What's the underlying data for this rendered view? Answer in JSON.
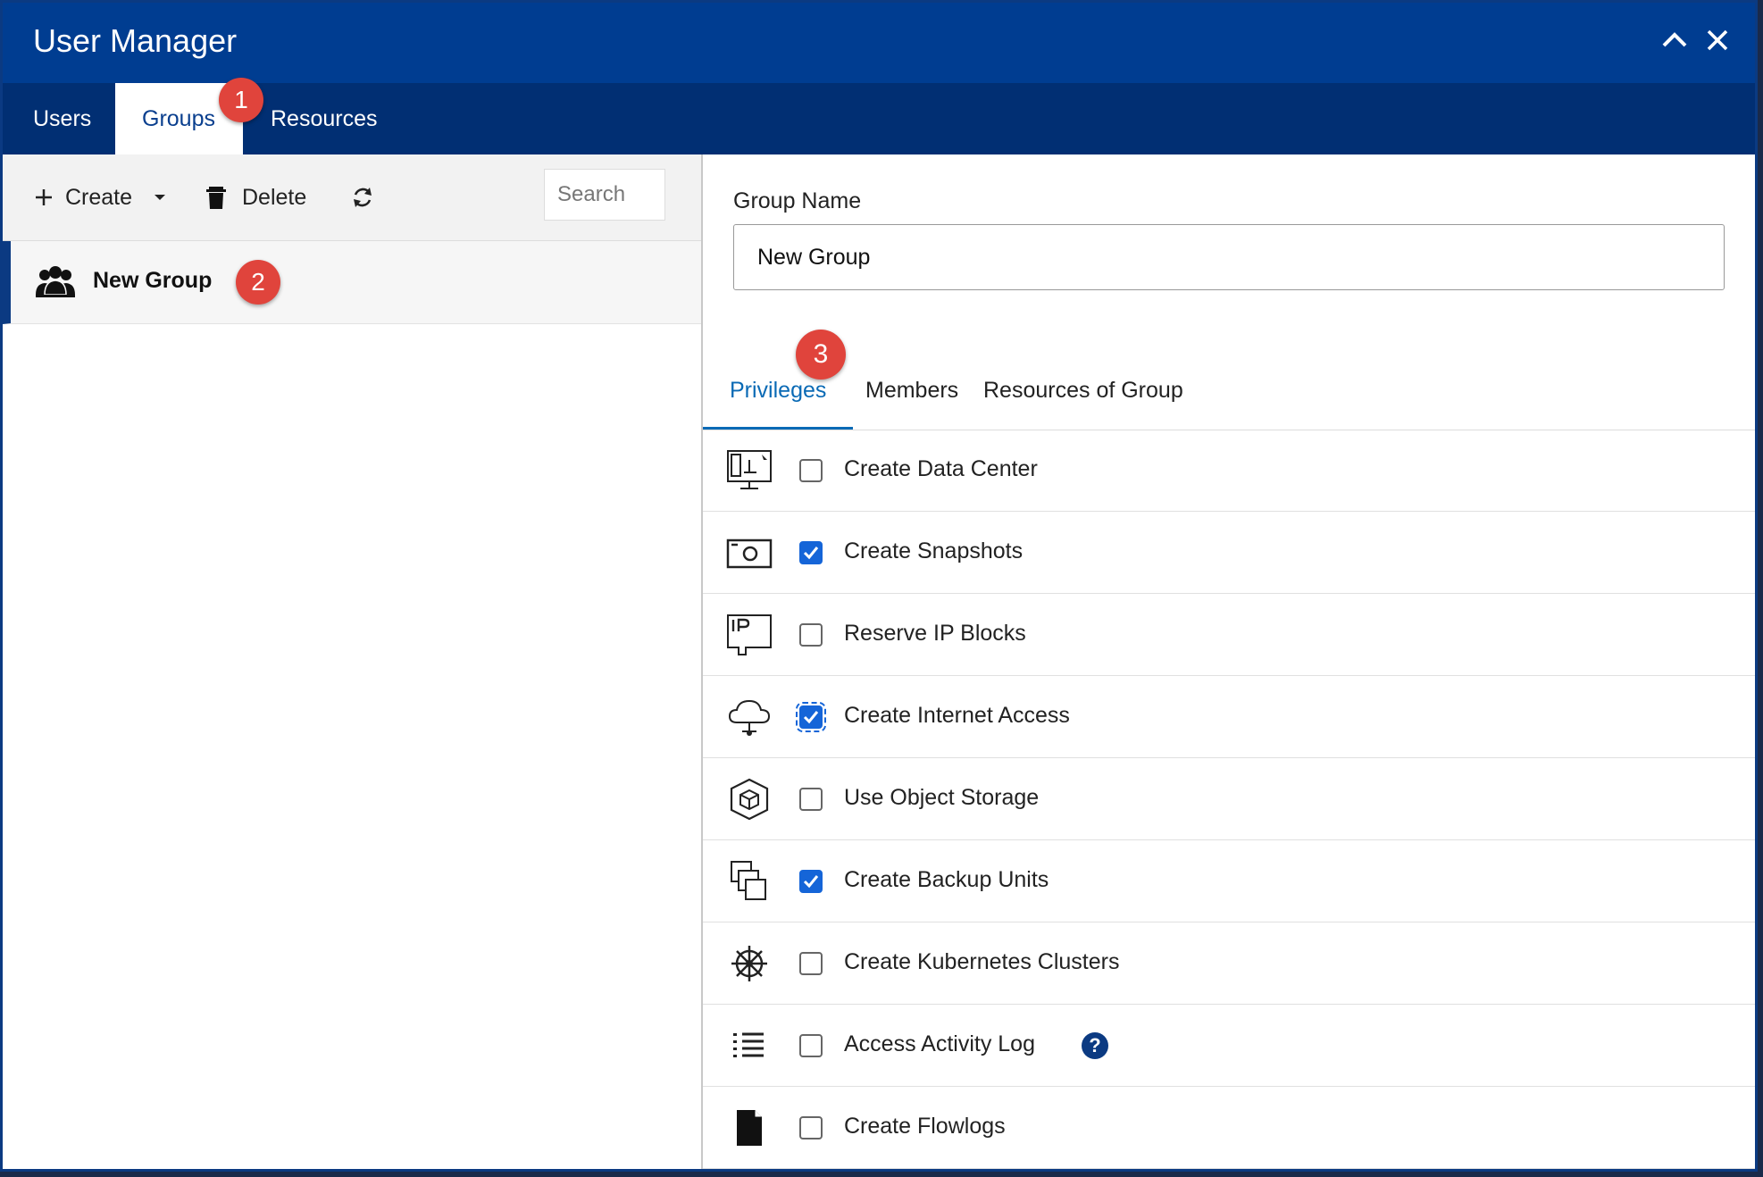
{
  "window": {
    "title": "User Manager"
  },
  "tabs": [
    {
      "label": "Users"
    },
    {
      "label": "Groups"
    },
    {
      "label": "Resources"
    }
  ],
  "toolbar": {
    "create_label": "Create",
    "delete_label": "Delete",
    "search_placeholder": "Search"
  },
  "groups": [
    {
      "name": "New Group"
    }
  ],
  "form": {
    "group_name_label": "Group Name",
    "group_name_value": "New Group"
  },
  "subtabs": [
    {
      "label": "Privileges"
    },
    {
      "label": "Members"
    },
    {
      "label": "Resources of Group"
    }
  ],
  "privileges": [
    {
      "label": "Create Data Center",
      "checked": false,
      "icon": "data-center-icon"
    },
    {
      "label": "Create Snapshots",
      "checked": true,
      "icon": "snapshot-icon"
    },
    {
      "label": "Reserve IP Blocks",
      "checked": false,
      "icon": "ip-block-icon"
    },
    {
      "label": "Create Internet Access",
      "checked": true,
      "icon": "cloud-icon"
    },
    {
      "label": "Use Object Storage",
      "checked": false,
      "icon": "object-storage-icon"
    },
    {
      "label": "Create Backup Units",
      "checked": true,
      "icon": "backup-icon"
    },
    {
      "label": "Create Kubernetes Clusters",
      "checked": false,
      "icon": "kubernetes-icon"
    },
    {
      "label": "Access Activity Log",
      "checked": false,
      "icon": "list-icon"
    },
    {
      "label": "Create Flowlogs",
      "checked": false,
      "icon": "document-icon"
    }
  ],
  "callouts": [
    "1",
    "2",
    "3"
  ],
  "colors": {
    "titlebar": "#003d91",
    "tabbar": "#012f73",
    "accent": "#0a6ab5",
    "checkbox": "#1565d8",
    "badge": "#e0443c"
  }
}
